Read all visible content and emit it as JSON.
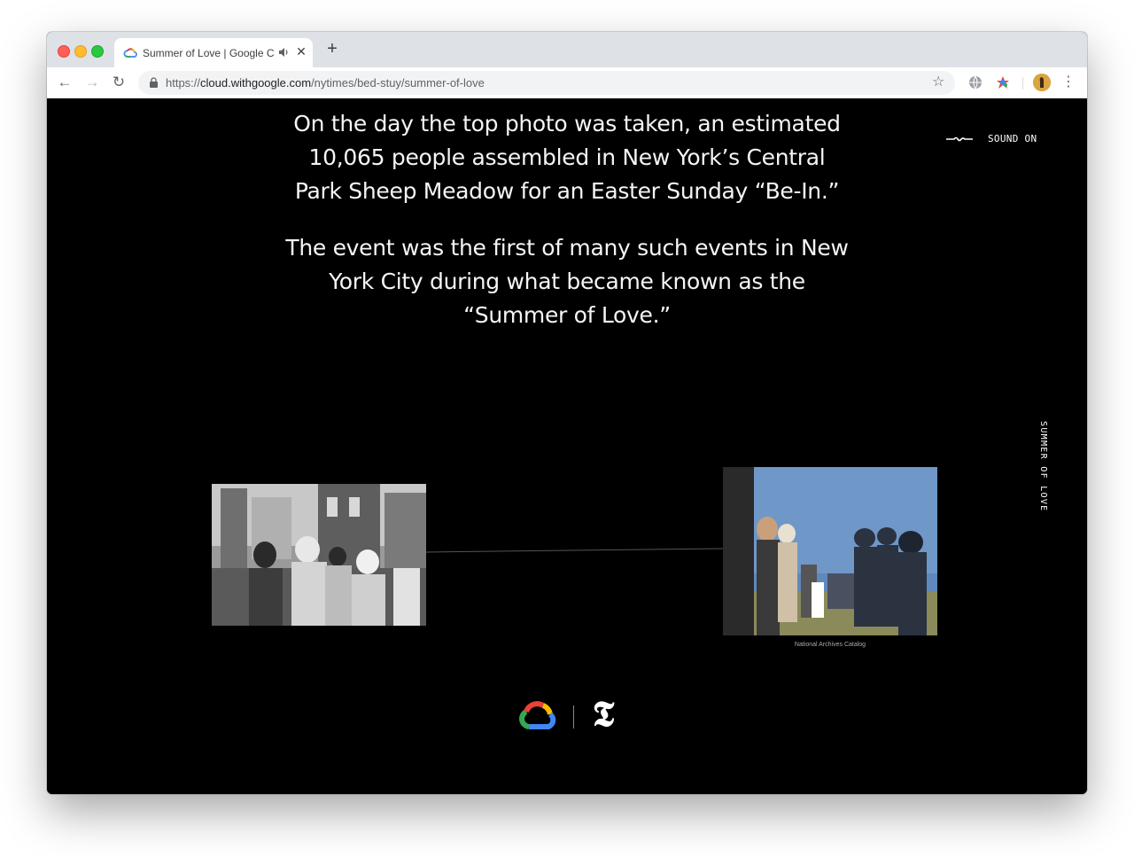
{
  "browser": {
    "tab": {
      "title": "Summer of Love | Google C",
      "close_glyph": "✕"
    },
    "new_tab_glyph": "+",
    "nav": {
      "back_glyph": "←",
      "forward_glyph": "→",
      "reload_glyph": "↻"
    },
    "url": {
      "scheme": "https://",
      "host": "cloud.withgoogle.com",
      "path": "/nytimes/bed-stuy/summer-of-love"
    },
    "bookmark_glyph": "☆",
    "menu_glyph": "⋮"
  },
  "page": {
    "paragraph_1": "On the day the top photo was taken, an estimated 10,065 people assembled in New York’s Central Park Sheep Meadow for an Easter Sunday “Be-In.”",
    "paragraph_2": "The event was the first of many such events in New York City during what became known as the “Summer of Love.”",
    "sound_toggle": "SOUND ON",
    "side_label": "SUMMER OF LOVE",
    "right_photo_caption": "National Archives Catalog",
    "nyt_logo_glyph": "𝕿"
  },
  "colors": {
    "page_background": "#000000",
    "text": "#ffffff",
    "tabstrip": "#dee1e6",
    "omnibox": "#f1f3f4"
  }
}
